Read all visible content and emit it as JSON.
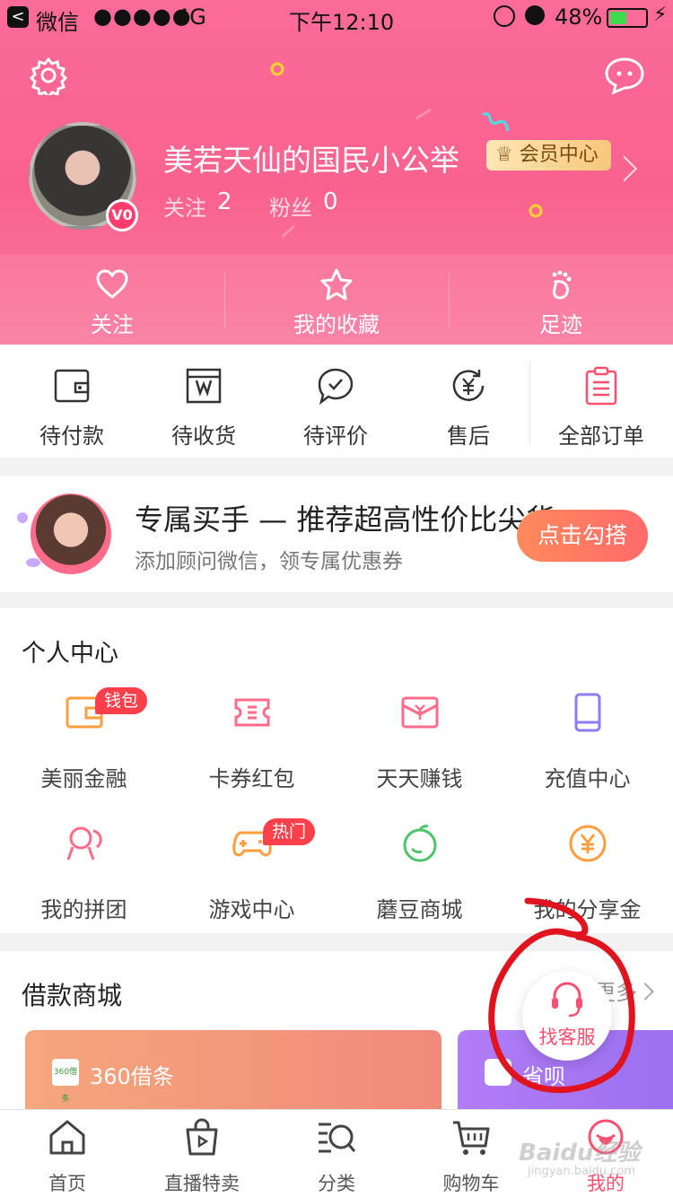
{
  "status_bar": {
    "back_label": "<",
    "app_name": "微信",
    "signal": "●●●●●",
    "network": "4G",
    "time": "下午12:10",
    "battery_percent": "48%",
    "battery_level": 0.48,
    "charging_glyph": "⚡"
  },
  "header": {
    "username": "美若天仙的国民小公举",
    "member_label": "会员中心",
    "level_badge": "V0",
    "follow_label": "关注",
    "follow_count": "2",
    "fans_label": "粉丝",
    "fans_count": "0",
    "tabs": [
      {
        "label": "关注",
        "icon": "heart-icon"
      },
      {
        "label": "我的收藏",
        "icon": "star-icon"
      },
      {
        "label": "足迹",
        "icon": "footprint-icon"
      }
    ]
  },
  "orders": [
    {
      "label": "待付款",
      "icon": "wallet-icon"
    },
    {
      "label": "待收货",
      "icon": "package-icon"
    },
    {
      "label": "待评价",
      "icon": "comment-check-icon"
    },
    {
      "label": "售后",
      "icon": "yen-refresh-icon"
    },
    {
      "label": "全部订单",
      "icon": "clipboard-icon"
    }
  ],
  "promo": {
    "title": "专属买手 — 推荐超高性价比尖货",
    "subtitle": "添加顾问微信，领专属优惠券",
    "button": "点击勾搭"
  },
  "personal_center": {
    "title": "个人中心",
    "items": [
      {
        "label": "美丽金融",
        "icon": "wallet-card-icon",
        "tag": "钱包",
        "color": "#ff9d3d"
      },
      {
        "label": "卡券红包",
        "icon": "ticket-icon",
        "tag": "",
        "color": "#ff6b8a"
      },
      {
        "label": "天天赚钱",
        "icon": "money-envelope-icon",
        "tag": "",
        "color": "#ff6b8a"
      },
      {
        "label": "充值中心",
        "icon": "phone-icon",
        "tag": "",
        "color": "#8e7cf0"
      },
      {
        "label": "我的拼团",
        "icon": "group-icon",
        "tag": "",
        "color": "#ff6b8a"
      },
      {
        "label": "游戏中心",
        "icon": "gamepad-icon",
        "tag": "热门",
        "color": "#ff9d3d"
      },
      {
        "label": "蘑豆商城",
        "icon": "bean-icon",
        "tag": "",
        "color": "#4cc46a"
      },
      {
        "label": "我的分享金",
        "icon": "yen-coin-icon",
        "tag": "",
        "color": "#ff9d3d"
      }
    ]
  },
  "loan": {
    "title": "借款商城",
    "more": "更多",
    "cards": [
      {
        "label": "360借条",
        "logo_text": "360借条"
      },
      {
        "label": "省呗"
      }
    ]
  },
  "customer_service": {
    "label": "找客服"
  },
  "tabbar": [
    {
      "label": "首页",
      "icon": "home-icon"
    },
    {
      "label": "直播特卖",
      "icon": "live-bag-icon"
    },
    {
      "label": "分类",
      "icon": "category-search-icon"
    },
    {
      "label": "购物车",
      "icon": "cart-icon"
    },
    {
      "label": "我的",
      "icon": "profile-icon",
      "active": true
    }
  ],
  "watermark": {
    "text": "Baidu经验",
    "sub": "jingyan.baidu.com"
  },
  "colors": {
    "brand_pink": "#f9628f",
    "accent": "#ff4f6e",
    "annotation_red": "#e0141e"
  }
}
